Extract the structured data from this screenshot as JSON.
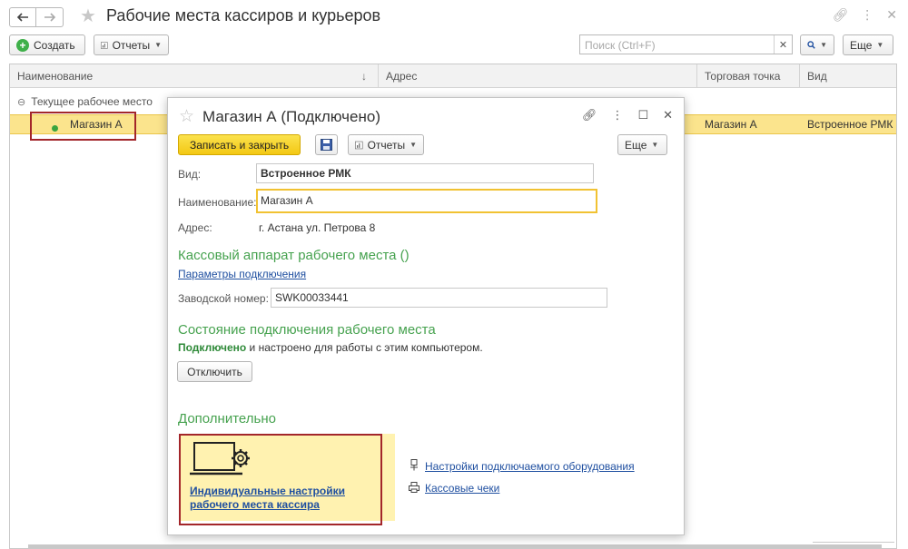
{
  "window": {
    "title": "Рабочие места кассиров и курьеров"
  },
  "toolbar": {
    "create_label": "Создать",
    "reports_label": "Отчеты",
    "search_placeholder": "Поиск (Ctrl+F)",
    "more_label": "Еще"
  },
  "table": {
    "columns": [
      "Наименование",
      "Адрес",
      "Торговая точка",
      "Вид"
    ],
    "sort_arrow": "↓",
    "group_label": "Текущее рабочее место",
    "rows": [
      {
        "name": "Магазин А",
        "address": "",
        "point": "Магазин А",
        "kind": "Встроенное РМК"
      }
    ]
  },
  "dialog": {
    "title": "Магазин А (Подключено)",
    "save_close_label": "Записать и закрыть",
    "reports_label": "Отчеты",
    "more_label": "Еще",
    "kind_label": "Вид:",
    "kind_value": "Встроенное РМК",
    "name_label": "Наименование:",
    "name_value": "Магазин А",
    "address_label": "Адрес:",
    "address_value": "г. Астана ул. Петрова 8",
    "cash_section": "Кассовый аппарат рабочего места ()",
    "connection_params_link": "Параметры подключения",
    "serial_label": "Заводской номер:",
    "serial_value": "SWK00033441",
    "state_section": "Состояние подключения рабочего места",
    "state_bold": "Подключено",
    "state_rest": " и настроено для работы с этим компьютером.",
    "disconnect_label": "Отключить",
    "extra_section": "Дополнительно",
    "individual_settings_line1": "Индивидуальные настройки",
    "individual_settings_line2": "рабочего места кассира",
    "equipment_link": "Настройки подключаемого оборудования",
    "receipts_link": "Кассовые чеки"
  },
  "colors": {
    "accent_green": "#46a24f",
    "selection_yellow": "#fbe48d",
    "primary_button": "#f3c814",
    "highlight_red": "#a3262a",
    "link_blue": "#1f4fa0"
  }
}
